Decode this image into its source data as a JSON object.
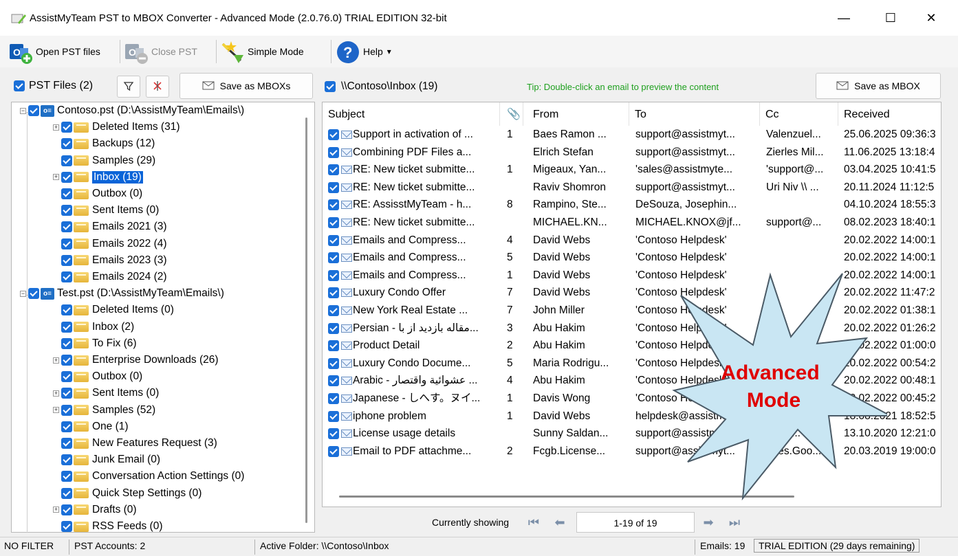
{
  "window": {
    "title": "AssistMyTeam PST to MBOX Converter - Advanced Mode (2.0.76.0) TRIAL EDITION 32-bit",
    "minimize": "—",
    "maximize": "☐",
    "close": "✕"
  },
  "toolbar": {
    "open_pst": "Open PST files",
    "close_pst": "Close PST",
    "simple_mode": "Simple Mode",
    "help": "Help",
    "help_arrow": "▾"
  },
  "left": {
    "pst_files_label": "PST Files (2)",
    "save_mboxs": "Save as MBOXs",
    "tree": [
      {
        "label": "Contoso.pst (D:\\AssistMyTeam\\Emails\\)",
        "type": "pst"
      },
      {
        "label": "Deleted Items (31)",
        "type": "folder",
        "expander": "+"
      },
      {
        "label": "Backups (12)",
        "type": "folder"
      },
      {
        "label": "Samples (29)",
        "type": "folder"
      },
      {
        "label": "Inbox (19)",
        "type": "folder",
        "expander": "+",
        "selected": true
      },
      {
        "label": "Outbox (0)",
        "type": "folder"
      },
      {
        "label": "Sent Items (0)",
        "type": "folder"
      },
      {
        "label": "Emails 2021 (3)",
        "type": "folder"
      },
      {
        "label": "Emails 2022 (4)",
        "type": "folder"
      },
      {
        "label": "Emails 2023 (3)",
        "type": "folder"
      },
      {
        "label": "Emails 2024 (2)",
        "type": "folder"
      },
      {
        "label": "Test.pst (D:\\AssistMyTeam\\Emails\\)",
        "type": "pst"
      },
      {
        "label": "Deleted Items (0)",
        "type": "folder"
      },
      {
        "label": "Inbox (2)",
        "type": "folder"
      },
      {
        "label": "To Fix (6)",
        "type": "folder"
      },
      {
        "label": "Enterprise Downloads (26)",
        "type": "folder",
        "expander": "+"
      },
      {
        "label": "Outbox (0)",
        "type": "folder"
      },
      {
        "label": "Sent Items (0)",
        "type": "folder",
        "expander": "+"
      },
      {
        "label": "Samples (52)",
        "type": "folder",
        "expander": "+"
      },
      {
        "label": "One (1)",
        "type": "folder"
      },
      {
        "label": "New Features Request (3)",
        "type": "folder"
      },
      {
        "label": "Junk Email (0)",
        "type": "folder"
      },
      {
        "label": "Conversation Action Settings (0)",
        "type": "folder"
      },
      {
        "label": "Quick Step Settings (0)",
        "type": "folder"
      },
      {
        "label": "Drafts (0)",
        "type": "folder",
        "expander": "+"
      },
      {
        "label": "RSS Feeds (0)",
        "type": "folder"
      }
    ]
  },
  "right": {
    "folder_label": "\\\\Contoso\\Inbox (19)",
    "tip": "Tip: Double-click an email to preview the content",
    "save_mbox": "Save as MBOX",
    "columns": {
      "subject": "Subject",
      "attach": "📎",
      "from": "From",
      "to": "To",
      "cc": "Cc",
      "received": "Received"
    },
    "rows": [
      {
        "subject": "Support in activation of ...",
        "att": "1",
        "from": "Baes Ramon ...",
        "to": "support@assistmyt...",
        "cc": "Valenzuel...",
        "received": "25.06.2025 09:36:3"
      },
      {
        "subject": "Combining PDF Files a...",
        "att": "",
        "from": "Elrich Stefan",
        "to": "support@assistmyt...",
        "cc": "Zierles Mil...",
        "received": "11.06.2025 13:18:4"
      },
      {
        "subject": "RE: New ticket submitte...",
        "att": "1",
        "from": "Migeaux, Yan...",
        "to": "'sales@assistmyte...",
        "cc": "'support@...",
        "received": "03.04.2025 10:41:5"
      },
      {
        "subject": "RE: New ticket submitte...",
        "att": "",
        "from": "Raviv Shomron",
        "to": "support@assistmyt...",
        "cc": "Uri Niv \\\\ ...",
        "received": "20.11.2024 11:12:5"
      },
      {
        "subject": "RE: AssisstMyTeam - h...",
        "att": "8",
        "from": "Rampino, Ste...",
        "to": "DeSouza, Josephin...",
        "cc": "",
        "received": "04.10.2024 18:55:3"
      },
      {
        "subject": "RE: New ticket submitte...",
        "att": "",
        "from": "MICHAEL.KN...",
        "to": "MICHAEL.KNOX@jf...",
        "cc": "support@...",
        "received": "08.02.2023 18:40:1"
      },
      {
        "subject": "Emails and Compress...",
        "att": "4",
        "from": "David Webs",
        "to": "'Contoso Helpdesk'",
        "cc": "",
        "received": "20.02.2022 14:00:1"
      },
      {
        "subject": "Emails and Compress...",
        "att": "5",
        "from": "David Webs",
        "to": "'Contoso Helpdesk'",
        "cc": "",
        "received": "20.02.2022 14:00:1"
      },
      {
        "subject": "Emails and Compress...",
        "att": "1",
        "from": "David Webs",
        "to": "'Contoso Helpdesk'",
        "cc": "",
        "received": "20.02.2022 14:00:1"
      },
      {
        "subject": "Luxury Condo Offer",
        "att": "7",
        "from": "David Webs",
        "to": "'Contoso Helpdesk'",
        "cc": "",
        "received": "20.02.2022 11:47:2"
      },
      {
        "subject": "New York Real Estate ...",
        "att": "7",
        "from": "John Miller",
        "to": "'Contoso Helpdesk'",
        "cc": "",
        "received": "20.02.2022 01:38:1"
      },
      {
        "subject": "Persian - مقاله بازدید از با...",
        "att": "3",
        "from": "Abu Hakim",
        "to": "'Contoso Helpdesk'",
        "cc": "",
        "received": "20.02.2022 01:26:2"
      },
      {
        "subject": "Product Detail",
        "att": "2",
        "from": "Abu Hakim",
        "to": "'Contoso Helpdesk'",
        "cc": "",
        "received": "20.02.2022 01:00:0"
      },
      {
        "subject": "Luxury Condo Docume...",
        "att": "5",
        "from": "Maria Rodrigu...",
        "to": "'Contoso Helpdesk'",
        "cc": "",
        "received": "20.02.2022 00:54:2"
      },
      {
        "subject": "Arabic - عشوائية واقتصار ...",
        "att": "4",
        "from": "Abu Hakim",
        "to": "'Contoso Helpdesk'",
        "cc": "",
        "received": "20.02.2022 00:48:1"
      },
      {
        "subject": "Japanese - しへす。ヌイ...",
        "att": "1",
        "from": "Davis Wong",
        "to": "'Contoso Helpdesk'",
        "cc": "",
        "received": "20.02.2022 00:45:2"
      },
      {
        "subject": "iphone problem",
        "att": "1",
        "from": "David Webs",
        "to": "helpdesk@assistm...",
        "cc": "",
        "received": "18.08.2021 18:52:5"
      },
      {
        "subject": "License usage details",
        "att": "",
        "from": "Sunny Saldan...",
        "to": "support@assistmyt...",
        "cc": "ALI A...",
        "received": "13.10.2020 12:21:0"
      },
      {
        "subject": "Email to PDF attachme...",
        "att": "2",
        "from": "Fcgb.License...",
        "to": "support@assistmyt...",
        "cc": "Yves.Goo...",
        "received": "20.03.2019 19:00:0"
      }
    ],
    "starburst_text_1": "Advanced",
    "starburst_text_2": "Mode"
  },
  "pager": {
    "currently_showing": "Currently showing",
    "range": "1-19 of 19",
    "first": "⏮",
    "prev": "⬅",
    "next": "➡",
    "last": "⏭"
  },
  "status": {
    "filter": "NO FILTER",
    "accounts": "PST Accounts: 2",
    "active_folder": "Active Folder: \\\\Contoso\\Inbox",
    "emails": "Emails: 19",
    "trial": "TRIAL EDITION (29 days remaining)"
  },
  "colors": {
    "accent": "#0a64d8",
    "tip_green": "#1fa01f",
    "starburst": "#c9e6f3",
    "starburst_text": "#e00000"
  }
}
